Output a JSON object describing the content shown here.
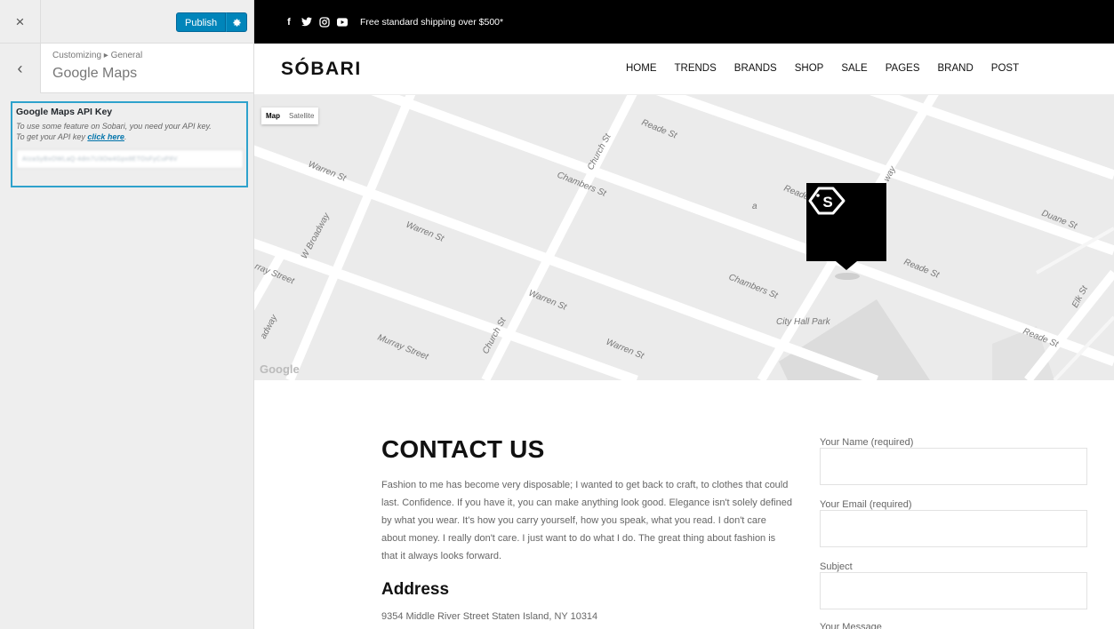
{
  "customizer": {
    "close_label": "×",
    "publish_label": "Publish",
    "breadcrumb": "Customizing ▸ General",
    "section_title": "Google Maps",
    "back_label": "‹",
    "control": {
      "label": "Google Maps API Key",
      "description_line1": "To use some feature on Sobari, you need your API key.",
      "description_line2_prefix": "To get your API key ",
      "link_text": "click here",
      "description_line2_suffix": ".",
      "value": "AIzaSyBxOWLaQ-4dm7U3Ow4Gpx8ETOsFyCuP8V"
    }
  },
  "preview": {
    "topbar": {
      "social_icons": [
        "facebook-icon",
        "twitter-icon",
        "instagram-icon",
        "youtube-icon"
      ],
      "shipping_text": "Free standard shipping over $500*"
    },
    "header": {
      "logo": "SÓBARI",
      "nav": [
        "HOME",
        "TRENDS",
        "BRANDS",
        "SHOP",
        "SALE",
        "PAGES",
        "BRAND",
        "POST"
      ]
    },
    "map": {
      "type_map": "Map",
      "type_satellite": "Satellite",
      "streets": [
        "Warren St",
        "W Broadway",
        "Warren St",
        "Church St",
        "Chambers St",
        "Reade St",
        "Reade St",
        "Duane St",
        "Murray Street",
        "Church St",
        "Warren St",
        "Warren St",
        "Chambers St",
        "City Hall Park",
        "Reade St",
        "Reade St",
        "Elk St",
        "rray Street",
        "adway",
        "way",
        "a"
      ],
      "attribution": "Google"
    },
    "contact": {
      "title": "CONTACT US",
      "body": "Fashion to me has become very disposable; I wanted to get back to craft, to clothes that could last. Confidence. If you have it, you can make anything look good. Elegance isn't solely defined by what you wear. It's how you carry yourself, how you speak, what you read. I don't care about money. I really don't care. I just want to do what I do. The great thing about fashion is that it always looks forward.",
      "address_title": "Address",
      "address_text": "9354 Middle River Street Staten Island, NY 10314"
    },
    "form": {
      "name_label": "Your Name (required)",
      "email_label": "Your Email (required)",
      "subject_label": "Subject",
      "message_label": "Your Message"
    }
  },
  "colors": {
    "accent": "#0085ba",
    "focus_border": "#2ea2cc",
    "topbar_bg": "#000000"
  }
}
